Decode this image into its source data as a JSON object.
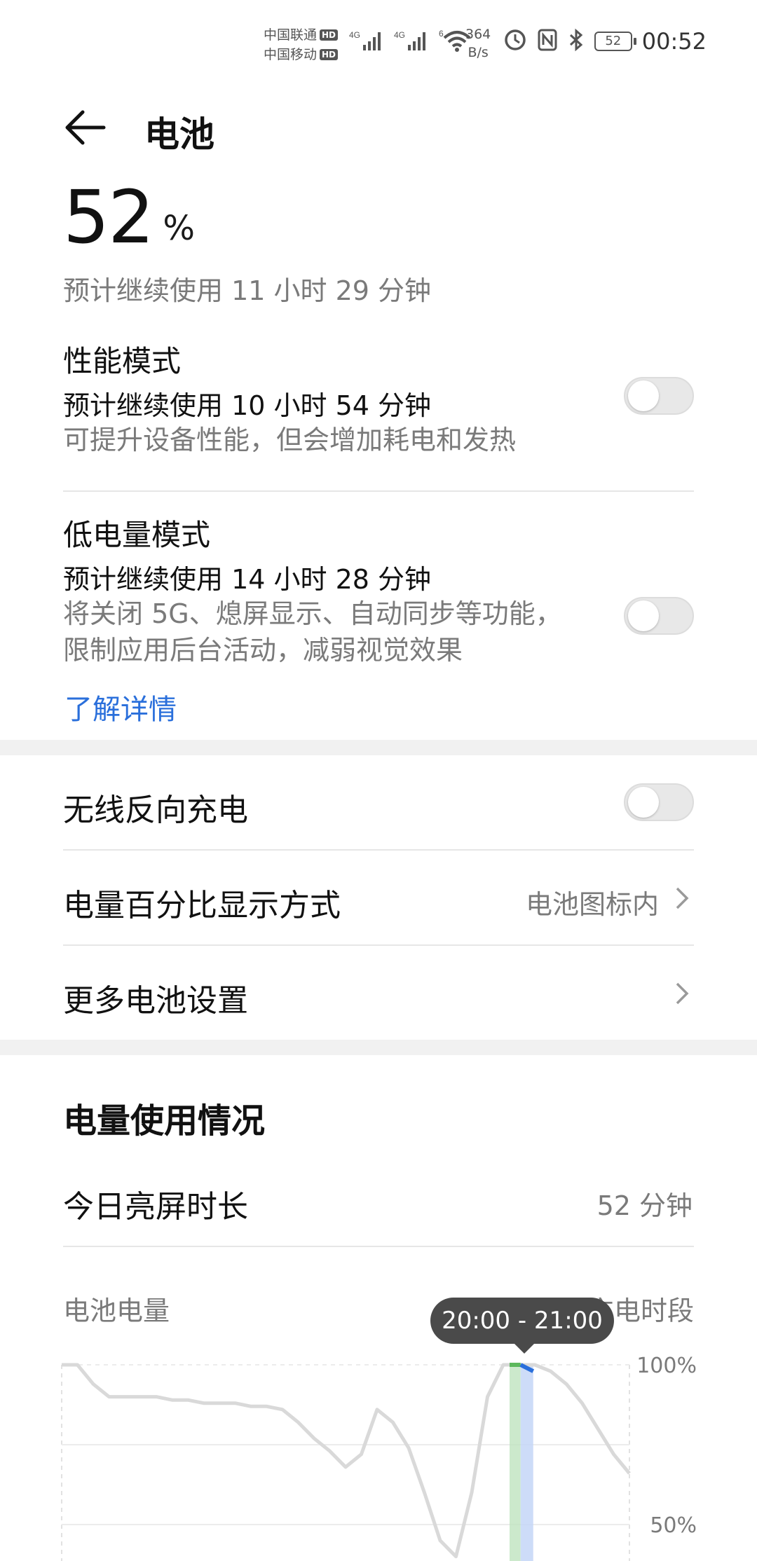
{
  "status_bar": {
    "carrier1": "中国联通",
    "carrier2": "中国移动",
    "hd": "HD",
    "net1": "4G",
    "net2": "4G",
    "wifi": "6",
    "speed_value": "364",
    "speed_unit": "B/s",
    "battery": "52",
    "time": "00:52"
  },
  "header": {
    "title": "电池"
  },
  "battery": {
    "percent": "52",
    "percent_sign": "%",
    "estimate": "预计继续使用 11 小时 29 分钟"
  },
  "performance_mode": {
    "title": "性能模式",
    "estimate": "预计继续使用 10 小时 54 分钟",
    "description": "可提升设备性能，但会增加耗电和发热",
    "enabled": false
  },
  "low_power_mode": {
    "title": "低电量模式",
    "estimate": "预计继续使用 14 小时 28 分钟",
    "description_line1": "将关闭 5G、熄屏显示、自动同步等功能，",
    "description_line2": "限制应用后台活动，减弱视觉效果",
    "enabled": false,
    "learn_more": "了解详情"
  },
  "settings": {
    "wireless_reverse_charging": "无线反向充电",
    "wireless_reverse_enabled": false,
    "percent_display": "电量百分比显示方式",
    "percent_display_value": "电池图标内",
    "more_settings": "更多电池设置"
  },
  "usage": {
    "title": "电量使用情况",
    "screen_on_label": "今日亮屏时长",
    "screen_on_value": "52 分钟",
    "chart_label": "电池电量",
    "legend_charging": "充电时段",
    "tooltip": "20:00 - 21:00"
  },
  "chart_data": {
    "type": "line",
    "title": "电池电量",
    "y_tick_labels": [
      "100%",
      "50%"
    ],
    "ylim": [
      0,
      100
    ],
    "x": [
      0,
      0.5,
      1,
      1.5,
      2,
      2.5,
      3,
      3.5,
      4,
      4.5,
      5,
      5.5,
      6,
      6.5,
      7,
      7.5,
      8,
      8.5,
      9,
      9.5,
      10,
      10.5,
      11,
      11.5,
      12,
      12.5,
      13,
      13.5,
      14,
      14.5,
      15,
      15.5,
      16,
      16.5,
      17,
      17.5,
      18
    ],
    "values": [
      100,
      100,
      94,
      90,
      90,
      90,
      90,
      89,
      89,
      88,
      88,
      88,
      87,
      87,
      86,
      82,
      77,
      73,
      68,
      72,
      86,
      82,
      74,
      60,
      45,
      40,
      60,
      90,
      100,
      100,
      100,
      98,
      94,
      88,
      80,
      72,
      66
    ],
    "highlight_charging": {
      "x_start": 14.2,
      "x_end": 14.55
    },
    "highlight_selected": {
      "x_start": 14.55,
      "x_end": 14.95
    },
    "grid": true,
    "colors": {
      "line": "#d9d9d9",
      "charging": "#bfe4bf",
      "selected": "#c4d6f7",
      "selected_line": "#2a6fdb"
    }
  }
}
